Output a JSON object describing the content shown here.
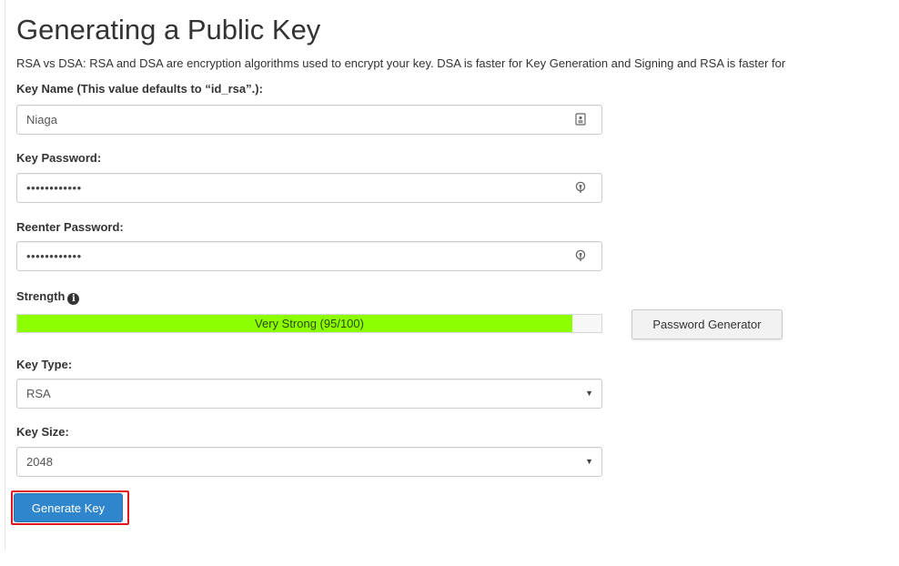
{
  "page": {
    "title": "Generating a Public Key",
    "description": "RSA vs DSA: RSA and DSA are encryption algorithms used to encrypt your key. DSA is faster for Key Generation and Signing and RSA is faster for"
  },
  "form": {
    "key_name": {
      "label": "Key Name (This value defaults to “id_rsa”.):",
      "value": "Niaga",
      "icon": "id-card-icon"
    },
    "key_password": {
      "label": "Key Password:",
      "value": "••••••••••••",
      "icon": "key-icon"
    },
    "reenter_password": {
      "label": "Reenter Password:",
      "value": "••••••••••••",
      "icon": "key-icon"
    },
    "strength": {
      "label": "Strength",
      "text": "Very Strong (95/100)",
      "score": 95,
      "max": 100,
      "color": "#8cff00"
    },
    "password_generator_label": "Password Generator",
    "key_type": {
      "label": "Key Type:",
      "selected": "RSA"
    },
    "key_size": {
      "label": "Key Size:",
      "selected": "2048"
    },
    "generate_label": "Generate Key"
  },
  "colors": {
    "primary_button": "#2f86cc",
    "highlight_outline": "#e0161c"
  }
}
